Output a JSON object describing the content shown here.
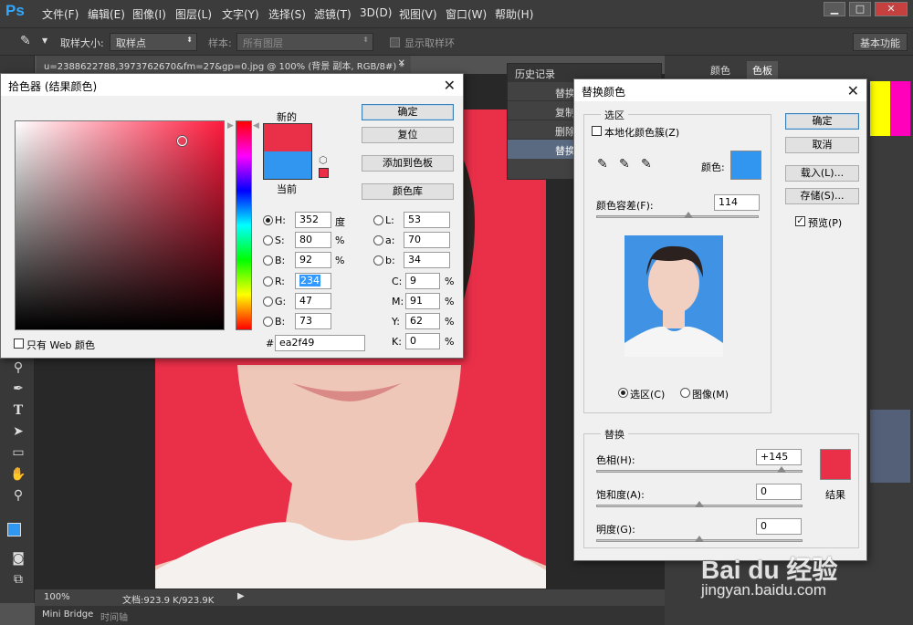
{
  "app": {
    "logo": "Ps"
  },
  "menu": [
    "文件(F)",
    "编辑(E)",
    "图像(I)",
    "图层(L)",
    "文字(Y)",
    "选择(S)",
    "滤镜(T)",
    "3D(D)",
    "视图(V)",
    "窗口(W)",
    "帮助(H)"
  ],
  "window_controls": {
    "minimize": "▁",
    "maximize": "□",
    "close": "✕"
  },
  "options": {
    "sample_size_label": "取样大小:",
    "sample_size_value": "取样点",
    "sample_label": "样本:",
    "sample_value": "所有图层",
    "show_ring_label": "显示取样环",
    "workspace": "基本功能"
  },
  "document_tab": "u=2388622788,3973762670&fm=27&gp=0.jpg @ 100% (背景 副本, RGB/8#) *",
  "status": {
    "zoom": "100%",
    "doc_size": "文档:923.9 K/923.9K"
  },
  "bottom_tabs": [
    "Mini Bridge",
    "时间轴"
  ],
  "right_panel": {
    "tabs": [
      "颜色",
      "色板"
    ]
  },
  "history_panel": {
    "title": "历史记录",
    "items": [
      "替换",
      "复制",
      "删除",
      "替换"
    ]
  },
  "watermark": {
    "brand": "Bai du 经验",
    "url": "jingyan.baidu.com"
  },
  "color_picker": {
    "title": "拾色器 (结果颜色)",
    "new_label": "新的",
    "current_label": "当前",
    "new_color": "#ea2f49",
    "current_color": "#3196f0",
    "buttons": {
      "ok": "确定",
      "reset": "复位",
      "add_swatch": "添加到色板",
      "libraries": "颜色库"
    },
    "web_only_label": "只有 Web 颜色",
    "hsb": [
      {
        "label": "H:",
        "value": "352",
        "unit": "度"
      },
      {
        "label": "S:",
        "value": "80",
        "unit": "%"
      },
      {
        "label": "B:",
        "value": "92",
        "unit": "%"
      }
    ],
    "rgb": [
      {
        "label": "R:",
        "value": "234"
      },
      {
        "label": "G:",
        "value": "47"
      },
      {
        "label": "B:",
        "value": "73"
      }
    ],
    "lab": [
      {
        "label": "L:",
        "value": "53"
      },
      {
        "label": "a:",
        "value": "70"
      },
      {
        "label": "b:",
        "value": "34"
      }
    ],
    "cmyk": [
      {
        "label": "C:",
        "value": "9",
        "unit": "%"
      },
      {
        "label": "M:",
        "value": "91",
        "unit": "%"
      },
      {
        "label": "Y:",
        "value": "62",
        "unit": "%"
      },
      {
        "label": "K:",
        "value": "0",
        "unit": "%"
      }
    ],
    "hex_prefix": "#",
    "hex": "ea2f49"
  },
  "replace_color": {
    "title": "替换颜色",
    "selection_group": "选区",
    "localized_clusters": "本地化颜色簇(Z)",
    "color_label": "颜色:",
    "selection_color": "#3196f0",
    "fuzziness_label": "颜色容差(F):",
    "fuzziness": "114",
    "fuzziness_level": 0.57,
    "mode_selection": "选区(C)",
    "mode_image": "图像(M)",
    "replace_group": "替换",
    "hue_label": "色相(H):",
    "hue": "+145",
    "hue_level": 0.9,
    "saturation_label": "饱和度(A):",
    "saturation": "0",
    "saturation_level": 0.5,
    "lightness_label": "明度(G):",
    "lightness": "0",
    "lightness_level": 0.5,
    "result_label": "结果",
    "result_color": "#ea2f49",
    "buttons": {
      "ok": "确定",
      "cancel": "取消",
      "load": "载入(L)...",
      "save": "存储(S)...",
      "preview": "预览(P)"
    }
  }
}
